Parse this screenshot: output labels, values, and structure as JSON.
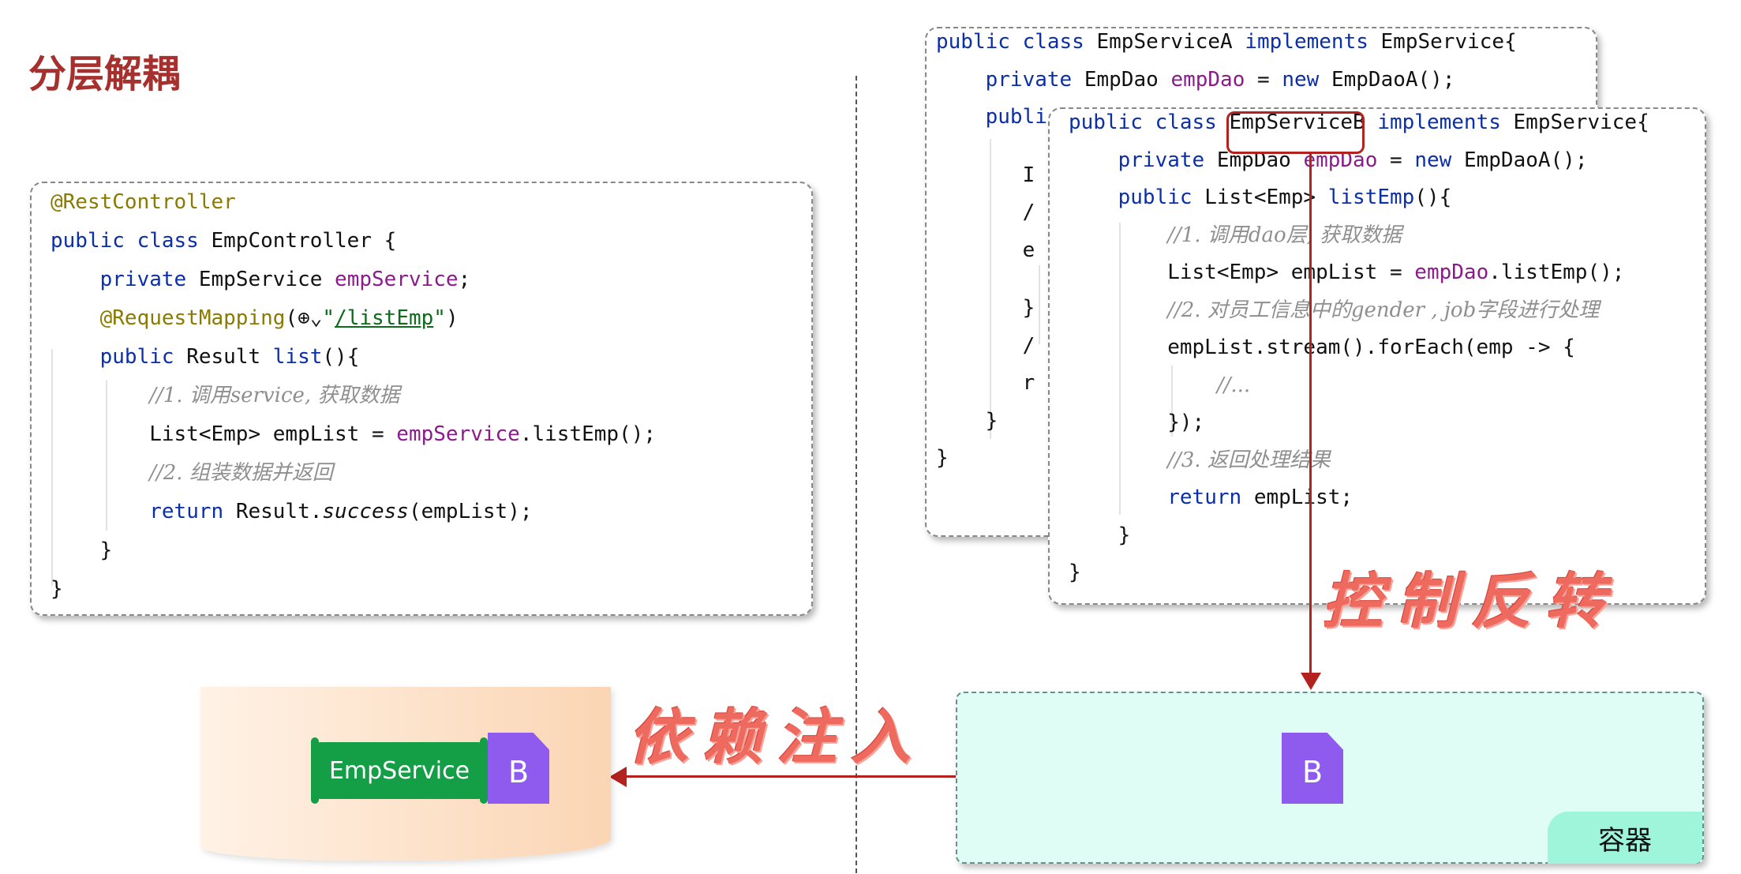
{
  "title": "分层解耦",
  "controller_code": [
    [
      {
        "t": "@RestController",
        "c": "ann"
      }
    ],
    [
      {
        "t": "public class ",
        "c": "kw"
      },
      {
        "t": "EmpController {"
      }
    ],
    [
      {
        "t": "    "
      },
      {
        "t": "private ",
        "c": "kw"
      },
      {
        "t": "EmpService "
      },
      {
        "t": "empService",
        "c": "field"
      },
      {
        "t": ";"
      }
    ],
    [
      {
        "t": "    "
      },
      {
        "t": "@RequestMapping",
        "c": "ann"
      },
      {
        "t": "(⊕⌄"
      },
      {
        "t": "\"",
        "c": "str"
      },
      {
        "t": "/listEmp",
        "c": "url"
      },
      {
        "t": "\"",
        "c": "str"
      },
      {
        "t": ")"
      }
    ],
    [
      {
        "t": "    "
      },
      {
        "t": "public ",
        "c": "kw"
      },
      {
        "t": "Result "
      },
      {
        "t": "list",
        "c": "kw"
      },
      {
        "t": "(){"
      }
    ],
    [
      {
        "t": "        "
      },
      {
        "t": "//1. 调用service, 获取数据",
        "c": "cmt"
      }
    ],
    [
      {
        "t": "        List<Emp> empList = "
      },
      {
        "t": "empService",
        "c": "field"
      },
      {
        "t": ".listEmp();"
      }
    ],
    [
      {
        "t": "        "
      },
      {
        "t": "//2. 组装数据并返回",
        "c": "cmt"
      }
    ],
    [
      {
        "t": "        "
      },
      {
        "t": "return ",
        "c": "kw"
      },
      {
        "t": "Result."
      },
      {
        "t": "success",
        "c": "it"
      },
      {
        "t": "(empList);"
      }
    ],
    [
      {
        "t": "    }"
      }
    ],
    [
      {
        "t": "}"
      }
    ]
  ],
  "service_a_code": [
    [
      {
        "t": "public class ",
        "c": "kw"
      },
      {
        "t": "EmpServiceA "
      },
      {
        "t": "implements ",
        "c": "kw"
      },
      {
        "t": "EmpService{"
      }
    ],
    [
      {
        "t": "    "
      },
      {
        "t": "private ",
        "c": "kw"
      },
      {
        "t": "EmpDao "
      },
      {
        "t": "empDao",
        "c": "field"
      },
      {
        "t": " = "
      },
      {
        "t": "new ",
        "c": "kw"
      },
      {
        "t": "EmpDaoA();"
      }
    ],
    [
      {
        "t": "    "
      },
      {
        "t": "publi",
        "c": "kw"
      }
    ],
    [
      {
        "t": ""
      }
    ],
    [
      {
        "t": "       I"
      }
    ],
    [
      {
        "t": "       /"
      }
    ],
    [
      {
        "t": "       e"
      }
    ],
    [
      {
        "t": ""
      }
    ],
    [
      {
        "t": "       }"
      }
    ],
    [
      {
        "t": "       /"
      }
    ],
    [
      {
        "t": "       r"
      }
    ],
    [
      {
        "t": "    }"
      }
    ],
    [
      {
        "t": "}"
      }
    ]
  ],
  "service_b_code": [
    [
      {
        "t": "public class ",
        "c": "kw"
      },
      {
        "t": "EmpServiceB "
      },
      {
        "t": "implements ",
        "c": "kw"
      },
      {
        "t": "EmpService{"
      }
    ],
    [
      {
        "t": "    "
      },
      {
        "t": "private ",
        "c": "kw"
      },
      {
        "t": "EmpDao "
      },
      {
        "t": "empDao",
        "c": "field"
      },
      {
        "t": " = "
      },
      {
        "t": "new ",
        "c": "kw"
      },
      {
        "t": "EmpDaoA();"
      }
    ],
    [
      {
        "t": "    "
      },
      {
        "t": "public ",
        "c": "kw"
      },
      {
        "t": "List<Emp> "
      },
      {
        "t": "listEmp",
        "c": "kw"
      },
      {
        "t": "(){"
      }
    ],
    [
      {
        "t": "        "
      },
      {
        "t": "//1. 调用dao层, 获取数据",
        "c": "cmt"
      }
    ],
    [
      {
        "t": "        List<Emp> empList = "
      },
      {
        "t": "empDao",
        "c": "field"
      },
      {
        "t": ".listEmp();"
      }
    ],
    [
      {
        "t": "        "
      },
      {
        "t": "//2. 对员工信息中的gender , job字段进行处理",
        "c": "cmt"
      }
    ],
    [
      {
        "t": "        empList.stream().forEach(emp -> {"
      }
    ],
    [
      {
        "t": "            "
      },
      {
        "t": "//...",
        "c": "cmt"
      }
    ],
    [
      {
        "t": "        });"
      }
    ],
    [
      {
        "t": "        "
      },
      {
        "t": "//3. 返回处理结果",
        "c": "cmt"
      }
    ],
    [
      {
        "t": "        "
      },
      {
        "t": "return ",
        "c": "kw"
      },
      {
        "t": "empList;"
      }
    ],
    [
      {
        "t": "    }"
      }
    ],
    [
      {
        "t": "}"
      }
    ]
  ],
  "labels": {
    "ioc": "控制反转",
    "di": "依赖注入",
    "container": "容器",
    "emp_service": "EmpService",
    "bean_letter": "B"
  },
  "colors": {
    "title": "#a5302d",
    "keyword": "#0b2fa8",
    "annotation": "#8a7a00",
    "field": "#8b1a8b",
    "comment": "#8f8f8f",
    "arrow": "#b3221f",
    "bean": "#8f5bef",
    "container_bg": "#dffdf4",
    "container_tab": "#9ff5da",
    "emp_service_tag": "#149e45"
  }
}
